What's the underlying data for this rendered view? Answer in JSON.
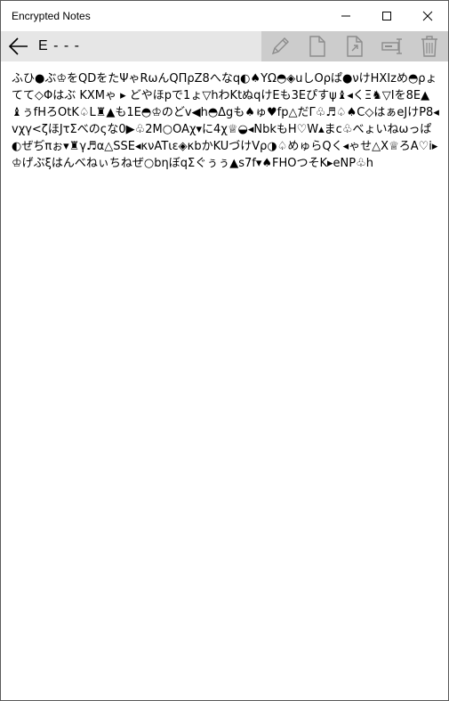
{
  "window": {
    "title": "Encrypted Notes"
  },
  "header": {
    "note_title": "E - - -"
  },
  "icons": {
    "back": "arrow-left-icon",
    "edit": "pencil-icon",
    "new_note": "document-icon",
    "export": "export-icon",
    "rename": "rename-icon",
    "delete": "trash-icon",
    "minimize": "minimize-icon",
    "maximize": "maximize-icon",
    "close": "close-icon"
  },
  "colors": {
    "command_bar": "#e6e6e6",
    "actions_bg": "#cccccc",
    "icon_gray": "#8c8c8c"
  },
  "note": {
    "body": "ふひ●ぶ♔をQDをたΨゃRωんQΠρZ8へなq◐♠YΩ◓◈uしOρぱ●νけHXIzめ◓ρょてて◇Φはぶ KXMゃ ▸ どやほpで1ょ▽hわKtぬqけEも3Eぴすψ♝◂くΞ♞▽Iを8E▲♝ぅfHろOtK♤L♜▲も1E◓♔のどv◀h◓Δgも♠ゅ♥fp△だΓ♧♬♤♠C◇はぁeJけP8◂vχγ<ζほJτΣべのςな0▶♧2M○OAχ▾に4χ♕◒◂NbkもH♡W▴まc♧べょいねωっぱ◐ぜぢπぉ▾♜γ♬α△SSE◂κνATιε◈κbかKUづけVρ◑♤めゅらQく◂ゃせ△X♕ろA♡i▸ ♔げぶξはんべねぃちねぜ○bηぼqΣぐぅぅ▲s7f▾♠FHOつそK▸eNP♧h"
  }
}
